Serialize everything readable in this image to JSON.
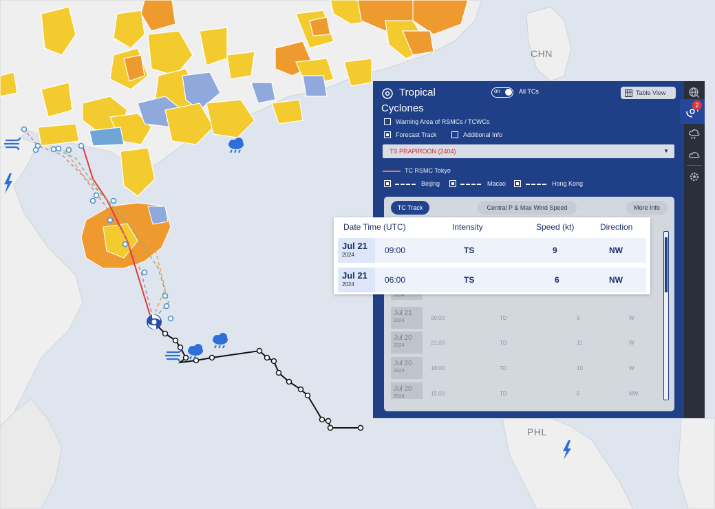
{
  "map": {
    "labels": {
      "chn": "CHN",
      "phl": "PHL"
    }
  },
  "panel": {
    "title_line1": "Tropical",
    "title_line2": "Cyclones",
    "toggle_label": "on",
    "all_tcs": "All TCs",
    "table_view": "Table View",
    "options": {
      "warning_area": "Warning Area of RSMCs / TCWCs",
      "forecast_track": "Forecast Track",
      "additional_info": "Additional Info"
    },
    "selected_storm": "TS PRAPIROON (2404)",
    "legend": {
      "main": "TC RSMC Tokyo",
      "beijing": "Beijing",
      "macao": "Macao",
      "hong_kong": "Hong Kong"
    },
    "tabs": [
      "TC Track",
      "Central P & Max Wind Speed",
      "More Info"
    ],
    "background_rows": [
      {
        "date": "Jul 21",
        "year": "2024",
        "time": "00:00",
        "intensity": "TD",
        "speed": "9",
        "direction": "W"
      },
      {
        "date": "Jul 20",
        "year": "2024",
        "time": "21:00",
        "intensity": "TD",
        "speed": "11",
        "direction": "W"
      },
      {
        "date": "Jul 20",
        "year": "2024",
        "time": "18:00",
        "intensity": "TD",
        "speed": "10",
        "direction": "W"
      },
      {
        "date": "Jul 20",
        "year": "2024",
        "time": "15:00",
        "intensity": "TD",
        "speed": "6",
        "direction": "NW"
      }
    ],
    "partial_row_year": "2024"
  },
  "rail": {
    "badge_count": "2"
  },
  "popup": {
    "headers": {
      "datetime": "Date Time (UTC)",
      "intensity": "Intensity",
      "speed": "Speed (kt)",
      "direction": "Direction"
    },
    "rows": [
      {
        "date": "Jul 21",
        "year": "2024",
        "time": "09:00",
        "intensity": "TS",
        "speed": "9",
        "direction": "NW"
      },
      {
        "date": "Jul 21",
        "year": "2024",
        "time": "06:00",
        "intensity": "TS",
        "speed": "6",
        "direction": "NW"
      }
    ]
  },
  "colors": {
    "sea": "#dfe5ee",
    "land": "#efefef",
    "yellow_warning": "#f3cb2f",
    "orange_warning": "#ef9a2e",
    "blue_warning": "#8fa9dc",
    "panel": "#1f3f87",
    "track_past": "#111111",
    "track_tokyo": "#e03a3a"
  }
}
